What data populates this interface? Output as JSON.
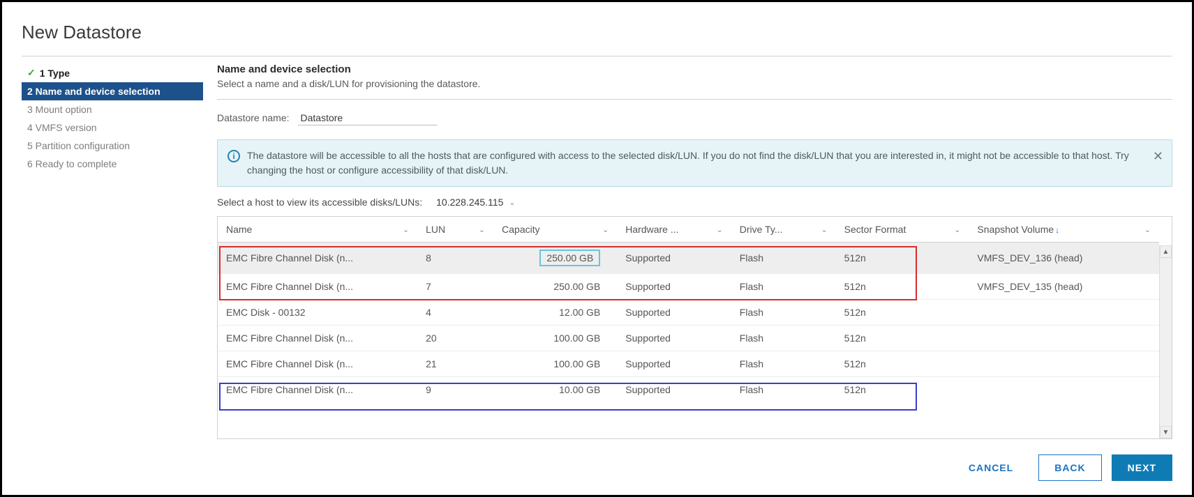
{
  "title": "New Datastore",
  "steps": [
    {
      "label": "1 Type",
      "state": "completed"
    },
    {
      "label": "2 Name and device selection",
      "state": "active"
    },
    {
      "label": "3 Mount option",
      "state": "pending"
    },
    {
      "label": "4 VMFS version",
      "state": "pending"
    },
    {
      "label": "5 Partition configuration",
      "state": "pending"
    },
    {
      "label": "6 Ready to complete",
      "state": "pending"
    }
  ],
  "section": {
    "heading": "Name and device selection",
    "description": "Select a name and a disk/LUN for provisioning the datastore."
  },
  "datastore_name": {
    "label": "Datastore name:",
    "value": "Datastore"
  },
  "info_banner": "The datastore will be accessible to all the hosts that are configured with access to the selected disk/LUN. If you do not find the disk/LUN that you are interested in, it might not be accessible to that host. Try changing the host or configure accessibility of that disk/LUN.",
  "host_selector": {
    "label": "Select a host to view its accessible disks/LUNs:",
    "value": "10.228.245.115"
  },
  "table": {
    "columns": [
      "Name",
      "LUN",
      "Capacity",
      "Hardware ...",
      "Drive Ty...",
      "Sector Format",
      "Snapshot Volume"
    ],
    "rows": [
      {
        "name": "EMC Fibre Channel Disk (n...",
        "lun": "8",
        "capacity": "250.00 GB",
        "hw": "Supported",
        "drive": "Flash",
        "sector": "512n",
        "snapshot": "VMFS_DEV_136 (head)",
        "selected": true,
        "cap_highlight": true
      },
      {
        "name": "EMC Fibre Channel Disk (n...",
        "lun": "7",
        "capacity": "250.00 GB",
        "hw": "Supported",
        "drive": "Flash",
        "sector": "512n",
        "snapshot": "VMFS_DEV_135 (head)"
      },
      {
        "name": "EMC Disk - 00132",
        "lun": "4",
        "capacity": "12.00 GB",
        "hw": "Supported",
        "drive": "Flash",
        "sector": "512n",
        "snapshot": ""
      },
      {
        "name": "EMC Fibre Channel Disk (n...",
        "lun": "20",
        "capacity": "100.00 GB",
        "hw": "Supported",
        "drive": "Flash",
        "sector": "512n",
        "snapshot": ""
      },
      {
        "name": "EMC Fibre Channel Disk (n...",
        "lun": "21",
        "capacity": "100.00 GB",
        "hw": "Supported",
        "drive": "Flash",
        "sector": "512n",
        "snapshot": ""
      },
      {
        "name": "EMC Fibre Channel Disk (n...",
        "lun": "9",
        "capacity": "10.00 GB",
        "hw": "Supported",
        "drive": "Flash",
        "sector": "512n",
        "snapshot": ""
      }
    ]
  },
  "buttons": {
    "cancel": "CANCEL",
    "back": "BACK",
    "next": "NEXT"
  }
}
